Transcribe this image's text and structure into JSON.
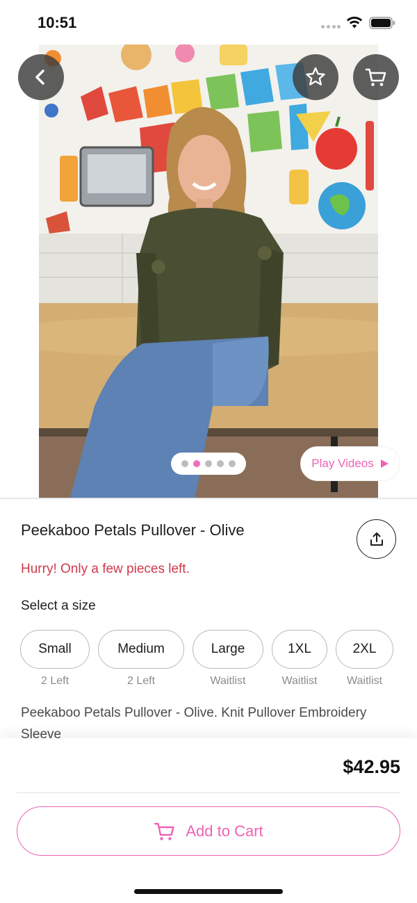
{
  "status_bar": {
    "time": "10:51"
  },
  "product": {
    "title": "Peekaboo Petals Pullover - Olive",
    "stock_alert": "Hurry! Only a few pieces left.",
    "image_description_icon": "product-photo",
    "gallery": {
      "image_count": 5,
      "active_index": 1
    },
    "play_videos_label": "Play Videos",
    "size_heading": "Select a size",
    "sizes": [
      {
        "label": "Small",
        "status": "2 Left"
      },
      {
        "label": "Medium",
        "status": "2 Left"
      },
      {
        "label": "Large",
        "status": "Waitlist"
      },
      {
        "label": "1XL",
        "status": "Waitlist"
      },
      {
        "label": "2XL",
        "status": "Waitlist"
      }
    ],
    "description": "Peekaboo Petals Pullover - Olive. Knit Pullover Embroidery Sleeve",
    "price": "$42.95"
  },
  "actions": {
    "add_to_cart_label": "Add to Cart"
  },
  "icons": {
    "back": "chevron-left-icon",
    "favorite": "star-icon",
    "cart": "cart-icon",
    "share": "share-icon",
    "play": "play-icon"
  },
  "colors": {
    "accent": "#ee63b3",
    "alert": "#d0394a",
    "pager_active": "#f06fbd"
  }
}
